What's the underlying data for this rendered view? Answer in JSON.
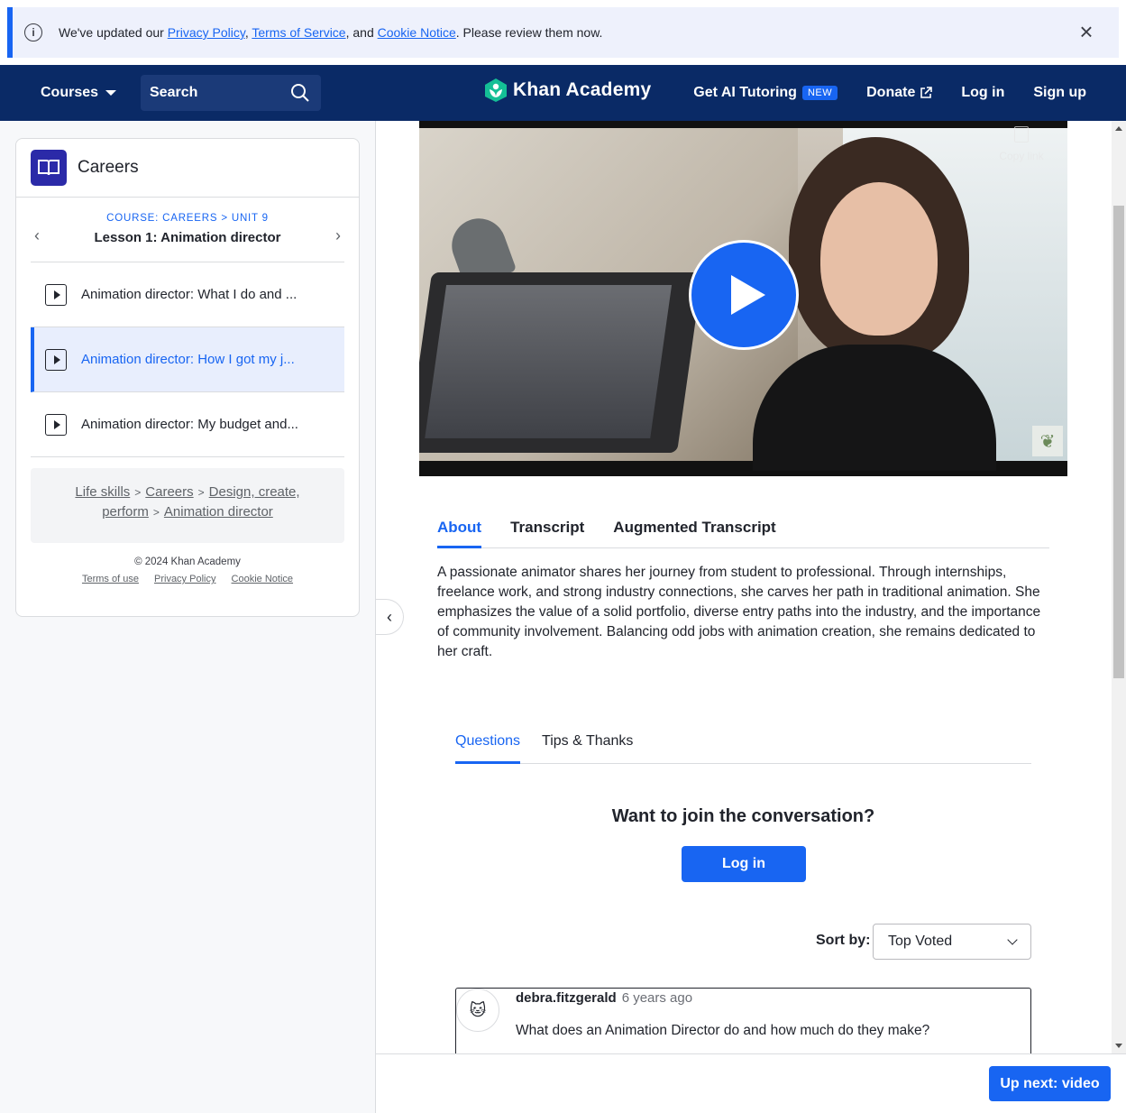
{
  "banner": {
    "prefix": "We've updated our ",
    "privacy": "Privacy Policy",
    "comma": ", ",
    "terms": "Terms of Service",
    "and": ", and ",
    "cookie": "Cookie Notice",
    "suffix": ". Please review them now."
  },
  "nav": {
    "courses": "Courses",
    "search": "Search",
    "logo": "Khan Academy",
    "ai_tutoring": "Get AI Tutoring",
    "new_badge": "NEW",
    "donate": "Donate",
    "login": "Log in",
    "signup": "Sign up"
  },
  "sidebar": {
    "course_title": "Careers",
    "crumbs": "COURSE: CAREERS > UNIT 9",
    "lesson_title": "Lesson 1: Animation director",
    "items": [
      {
        "label": "Animation director: What I do and ..."
      },
      {
        "label": "Animation director: How I got my j..."
      },
      {
        "label": "Animation director: My budget and..."
      }
    ],
    "breadcrumb": {
      "life_skills": "Life skills",
      "careers": "Careers",
      "design": "Design, create,",
      "perform": "perform",
      "animation": "Animation director",
      "sep": ">"
    },
    "copyright": "© 2024 Khan Academy",
    "terms_of_use": "Terms of use",
    "privacy_policy": "Privacy Policy",
    "cookie_notice": "Cookie Notice"
  },
  "video": {
    "copy_link": "Copy link"
  },
  "tabs": {
    "about": "About",
    "transcript": "Transcript",
    "augmented": "Augmented Transcript"
  },
  "about_text": "A passionate animator shares her journey from student to professional. Through internships, freelance work, and strong industry connections, she carves her path in traditional animation. She emphasizes the value of a solid portfolio, diverse entry paths into the industry, and the importance of community involvement. Balancing odd jobs with animation creation, she remains dedicated to her craft.",
  "discussion": {
    "questions_tab": "Questions",
    "tips_tab": "Tips & Thanks",
    "join_prompt": "Want to join the conversation?",
    "login_button": "Log in",
    "sort_label": "Sort by:",
    "sort_value": "Top Voted"
  },
  "question": {
    "author": "debra.fitzgerald",
    "when": "6 years ago",
    "text": "What does an Animation Director do and how much do they make?"
  },
  "upnext": "Up next: video",
  "colors": {
    "brand_blue": "#1865f2",
    "nav_bg": "#0a2a66"
  }
}
